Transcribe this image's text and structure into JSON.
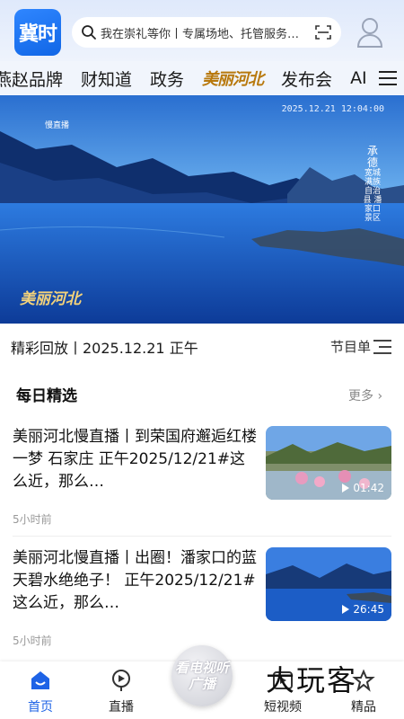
{
  "header": {
    "logo_text": "冀时",
    "search_placeholder": "我在崇礼等你丨专属场地、托管服务…",
    "icons": [
      "search-icon",
      "scan-icon",
      "profile-icon"
    ]
  },
  "nav": {
    "tabs": [
      "燕赵品牌",
      "财知道",
      "政务",
      "美丽河北",
      "发布会",
      "AI"
    ],
    "menu_icon": "menu-icon"
  },
  "hero": {
    "timestamp": "2025.12.21 12:04:00",
    "brand": "美丽河北",
    "tag": "慢直播",
    "location_title": "承德",
    "location_sub": "宽城满族自治县 潘家口景区",
    "colors": {
      "sky": "#1b63c9",
      "water": "#0b3a9a"
    }
  },
  "replay": {
    "title": "精彩回放丨2025.12.21 正午",
    "schedule_label": "节目单"
  },
  "section": {
    "title": "每日精选",
    "more_label": "更多 ›"
  },
  "news": [
    {
      "headline": "美丽河北慢直播丨到荣国府邂逅红楼一梦 石家庄 正午2025/12/21#这么近，那么…",
      "time": "5小时前",
      "duration": "01:42"
    },
    {
      "headline": "美丽河北慢直播丨出圈！潘家口的蓝天碧水绝绝子！ 正午2025/12/21#这么近，那么…",
      "time": "5小时前",
      "duration": "26:45"
    }
  ],
  "tabbar": {
    "items": [
      {
        "label": "首页",
        "icon": "home-icon",
        "active": true
      },
      {
        "label": "直播",
        "icon": "live-icon",
        "active": false
      },
      {
        "label": "短视频",
        "icon": "short-video-icon",
        "active": false
      },
      {
        "label": "精品",
        "icon": "premium-icon",
        "active": false
      }
    ],
    "center_label": "看电视听广播",
    "accent": "#1e63e6"
  },
  "watermark": "大玩客"
}
